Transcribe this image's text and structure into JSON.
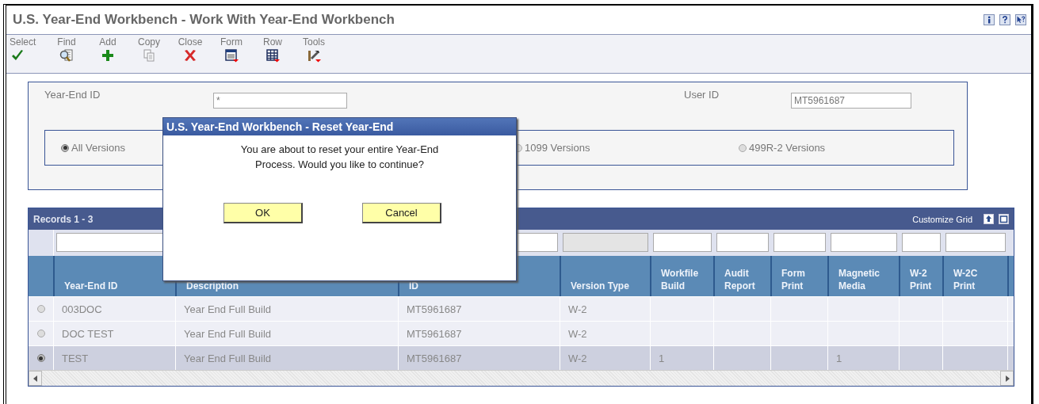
{
  "window": {
    "title": "U.S. Year-End Workbench - Work With Year-End Workbench"
  },
  "toolbar": [
    {
      "label": "Select",
      "disabled": false
    },
    {
      "label": "Find",
      "disabled": false
    },
    {
      "label": "Add",
      "disabled": false
    },
    {
      "label": "Copy",
      "disabled": true
    },
    {
      "label": "Close",
      "disabled": false
    },
    {
      "label": "Form",
      "disabled": false
    },
    {
      "label": "Row",
      "disabled": false
    },
    {
      "label": "Tools",
      "disabled": false
    }
  ],
  "form": {
    "year_end_id": {
      "label": "Year-End ID",
      "value": "*"
    },
    "user_id": {
      "label": "User ID",
      "value": "MT5961687"
    },
    "versions": [
      {
        "label": "All Versions",
        "selected": true
      },
      {
        "label": "1099 Versions",
        "selected": false
      },
      {
        "label": "499R-2 Versions",
        "selected": false
      }
    ]
  },
  "grid": {
    "title": "Records 1 - 3",
    "customize": "Customize Grid",
    "columns": [
      {
        "label": "Year-End ID",
        "filter_disabled": false
      },
      {
        "label": "Description"
      },
      {
        "label": "ID",
        "filter_disabled": false
      },
      {
        "label": "Version Type",
        "filter_disabled": true
      },
      {
        "label": "Workfile Build",
        "filter_disabled": false
      },
      {
        "label": "Audit Report",
        "filter_disabled": false
      },
      {
        "label": "Form Print",
        "filter_disabled": false
      },
      {
        "label": "Magnetic Media",
        "filter_disabled": false
      },
      {
        "label": "W-2 Print",
        "filter_disabled": false
      },
      {
        "label": "W-2C Print",
        "filter_disabled": false
      }
    ],
    "rows": [
      {
        "selected": false,
        "cells": [
          "003DOC",
          "Year End Full Build",
          "MT5961687",
          "W-2",
          "",
          "",
          "",
          "",
          "",
          ""
        ]
      },
      {
        "selected": false,
        "cells": [
          "DOC TEST",
          "Year End Full Build",
          "MT5961687",
          "W-2",
          "",
          "",
          "",
          "",
          "",
          ""
        ]
      },
      {
        "selected": true,
        "cells": [
          "TEST",
          "Year End Full Build",
          "MT5961687",
          "W-2",
          "1",
          "",
          "",
          "1",
          "",
          ""
        ]
      }
    ]
  },
  "dialog": {
    "title": "U.S. Year-End Workbench - Reset Year-End",
    "message": "You are about to reset your entire Year-End Process. Would you like to continue?",
    "buttons": [
      "OK",
      "Cancel"
    ]
  }
}
